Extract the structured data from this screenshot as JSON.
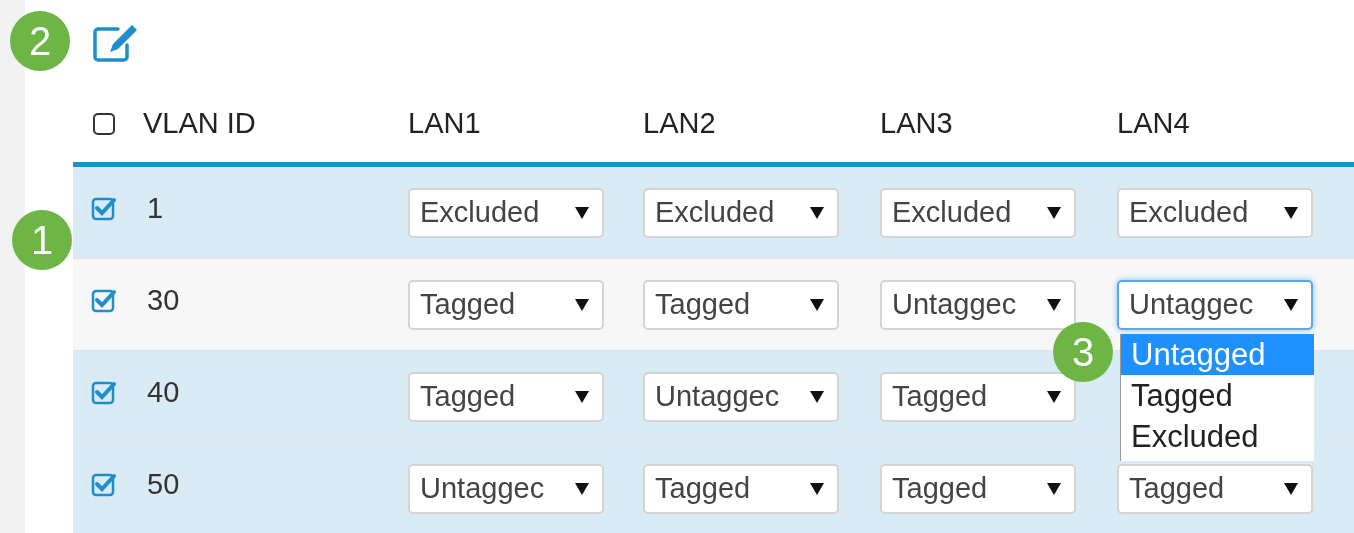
{
  "header": {
    "select_all_checked": false,
    "columns": [
      "VLAN ID",
      "LAN1",
      "LAN2",
      "LAN3",
      "LAN4"
    ]
  },
  "rows": [
    {
      "checked": true,
      "highlighted": true,
      "vlan_id": "1",
      "ports": [
        {
          "value": "Excluded",
          "focused": false
        },
        {
          "value": "Excluded",
          "focused": false
        },
        {
          "value": "Excluded",
          "focused": false
        },
        {
          "value": "Excluded",
          "focused": false
        }
      ]
    },
    {
      "checked": true,
      "highlighted": false,
      "vlan_id": "30",
      "ports": [
        {
          "value": "Tagged",
          "focused": false
        },
        {
          "value": "Tagged",
          "focused": false
        },
        {
          "value": "Untaggec",
          "focused": false
        },
        {
          "value": "Untaggec",
          "focused": true,
          "options": [
            {
              "label": "Untagged",
              "selected": true
            },
            {
              "label": "Tagged",
              "selected": false
            },
            {
              "label": "Excluded",
              "selected": false
            }
          ]
        }
      ]
    },
    {
      "checked": true,
      "highlighted": true,
      "vlan_id": "40",
      "ports": [
        {
          "value": "Tagged",
          "focused": false
        },
        {
          "value": "Untaggec",
          "focused": false
        },
        {
          "value": "Tagged",
          "focused": false
        }
      ]
    },
    {
      "checked": true,
      "highlighted": true,
      "vlan_id": "50",
      "ports": [
        {
          "value": "Untaggec",
          "focused": false
        },
        {
          "value": "Tagged",
          "focused": false
        },
        {
          "value": "Tagged",
          "focused": false
        },
        {
          "value": "Tagged",
          "focused": false
        }
      ]
    }
  ],
  "callouts": [
    {
      "label": "2"
    },
    {
      "label": "1"
    },
    {
      "label": "3"
    }
  ]
}
